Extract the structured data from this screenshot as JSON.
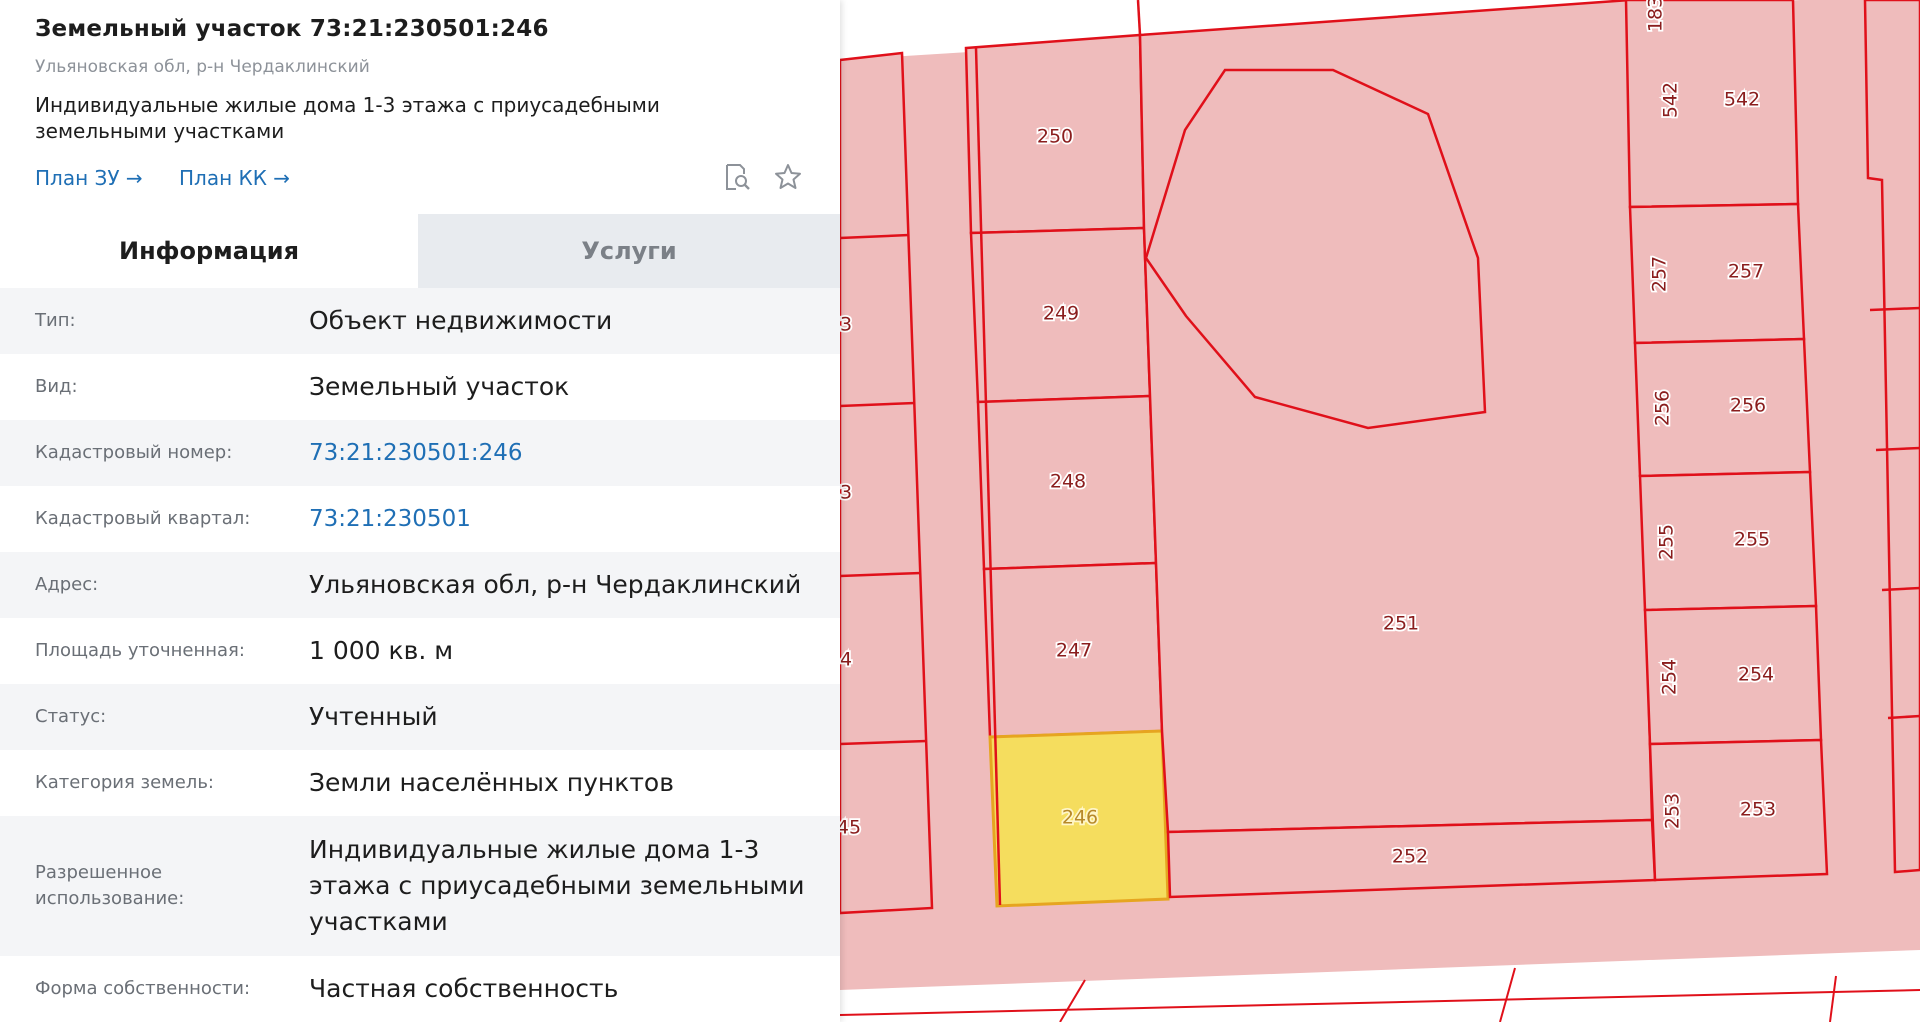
{
  "header": {
    "title": "Земельный участок 73:21:230501:246",
    "subtitle": "Ульяновская обл, р-н Чердаклинский",
    "usage": "Индивидуальные жилые дома 1-3 этажа с приусадебными земельными участками",
    "links": [
      {
        "label": "План ЗУ →"
      },
      {
        "label": "План КК →"
      }
    ],
    "icons": [
      "search-document-icon",
      "star-icon"
    ]
  },
  "tabs": [
    {
      "label": "Информация",
      "active": true
    },
    {
      "label": "Услуги",
      "active": false
    }
  ],
  "info": [
    {
      "key": "Тип:",
      "value": "Объект недвижимости"
    },
    {
      "key": "Вид:",
      "value": "Земельный участок"
    },
    {
      "key": "Кадастровый номер:",
      "value": "73:21:230501:246",
      "link": true
    },
    {
      "key": "Кадастровый квартал:",
      "value": "73:21:230501",
      "link": true
    },
    {
      "key": "Адрес:",
      "value": "Ульяновская обл, р-н Чердаклинский"
    },
    {
      "key": "Площадь уточненная:",
      "value": "1 000 кв. м"
    },
    {
      "key": "Статус:",
      "value": "Учтенный"
    },
    {
      "key": "Категория земель:",
      "value": "Земли населённых пунктов"
    },
    {
      "key": "Разрешенное использование:",
      "value": "Индивидуальные жилые дома 1-3 этажа с приусадебными земельными участками"
    },
    {
      "key": "Форма собственности:",
      "value": "Частная собственность"
    }
  ],
  "map": {
    "colors": {
      "parcel_fill": "#efbcbc",
      "parcel_line": "#e0101a",
      "selected_fill": "#f5dd5e",
      "selected_line": "#e6a520",
      "label": "#8a1d1d"
    },
    "lot_labels": [
      "250",
      "249",
      "248",
      "247",
      "246",
      "251",
      "252",
      "542",
      "542",
      "257",
      "257",
      "256",
      "256",
      "255",
      "255",
      "254",
      "254",
      "253",
      "253",
      "183",
      "3",
      "3",
      "4",
      "45"
    ],
    "selected_lot": "246"
  }
}
